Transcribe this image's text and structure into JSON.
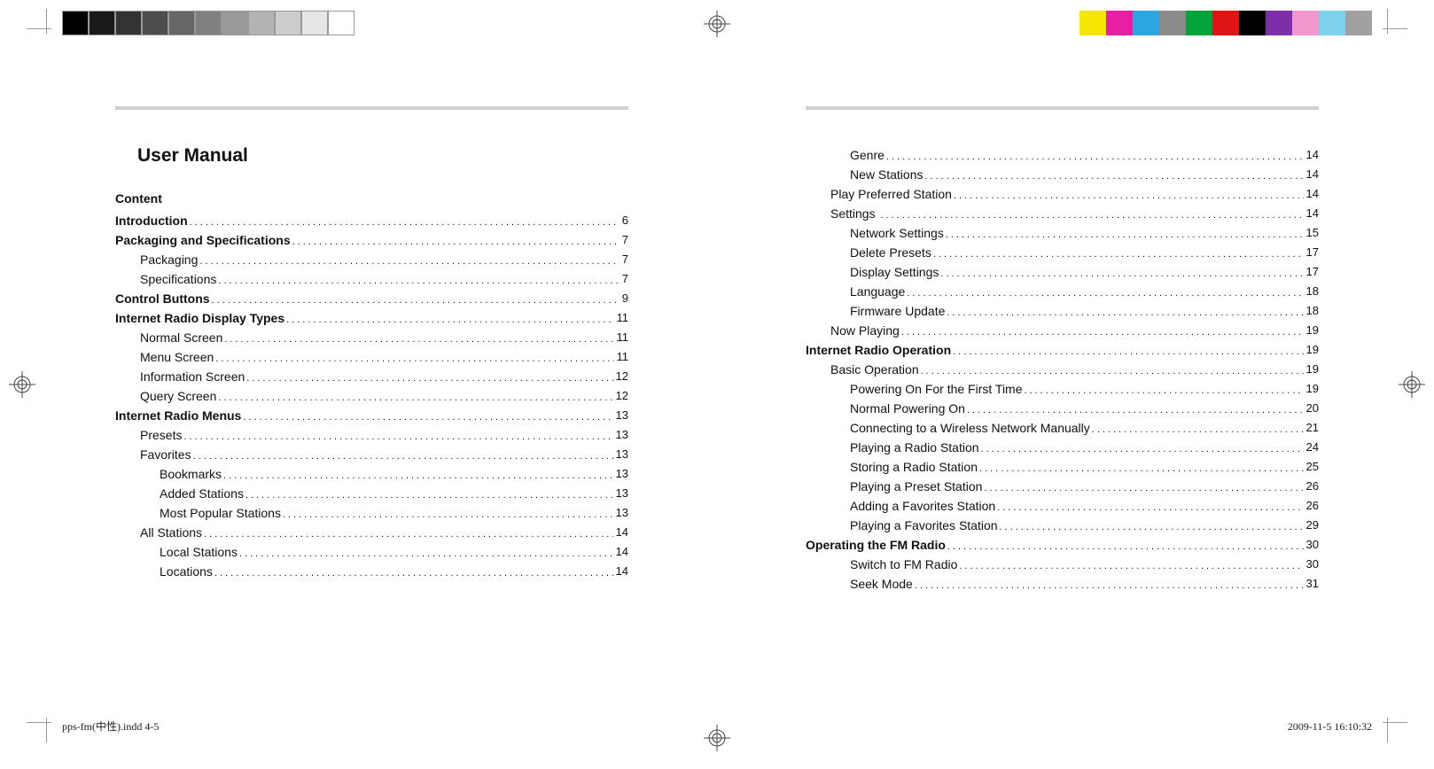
{
  "title": "User Manual",
  "content_label": "Content",
  "footer_left": "pps-fm(中性).indd   4-5",
  "footer_right": "2009-11-5   16:10:32",
  "colorbar_left": [
    "#000000",
    "#1a1a1a",
    "#333333",
    "#4d4d4d",
    "#666666",
    "#808080",
    "#999999",
    "#b3b3b3",
    "#cccccc",
    "#e6e6e6",
    "#ffffff"
  ],
  "colorbar_right": [
    "#f5e600",
    "#e81fa3",
    "#2da6e0",
    "#8b8b8b",
    "#00a43a",
    "#e01414",
    "#000000",
    "#7c2fa8",
    "#f397cf",
    "#7ed1ec",
    "#a0a0a0"
  ],
  "toc_left": [
    {
      "label": "Introduction",
      "page": "6",
      "bold": true,
      "indent": 0
    },
    {
      "label": "Packaging and Specifications",
      "page": "7",
      "bold": true,
      "indent": 0
    },
    {
      "label": "Packaging",
      "page": "7",
      "bold": false,
      "indent": 1
    },
    {
      "label": "Specifications",
      "page": "7",
      "bold": false,
      "indent": 1
    },
    {
      "label": "Control Buttons",
      "page": "9",
      "bold": true,
      "indent": 0
    },
    {
      "label": "Internet Radio Display Types",
      "page": "11",
      "bold": true,
      "indent": 0
    },
    {
      "label": "Normal Screen",
      "page": "11",
      "bold": false,
      "indent": 1
    },
    {
      "label": "Menu Screen",
      "page": "11",
      "bold": false,
      "indent": 1
    },
    {
      "label": "Information Screen",
      "page": "12",
      "bold": false,
      "indent": 1
    },
    {
      "label": "Query Screen",
      "page": "12",
      "bold": false,
      "indent": 1
    },
    {
      "label": "Internet Radio Menus",
      "page": "13",
      "bold": true,
      "indent": 0
    },
    {
      "label": "Presets",
      "page": "13",
      "bold": false,
      "indent": 1
    },
    {
      "label": "Favorites",
      "page": "13",
      "bold": false,
      "indent": 1
    },
    {
      "label": "Bookmarks",
      "page": "13",
      "bold": false,
      "indent": 2
    },
    {
      "label": "Added Stations",
      "page": "13",
      "bold": false,
      "indent": 2
    },
    {
      "label": "Most Popular Stations",
      "page": "13",
      "bold": false,
      "indent": 2
    },
    {
      "label": "All Stations",
      "page": "14",
      "bold": false,
      "indent": 1
    },
    {
      "label": "Local Stations",
      "page": "14",
      "bold": false,
      "indent": 2
    },
    {
      "label": "Locations",
      "page": "14",
      "bold": false,
      "indent": 2
    }
  ],
  "toc_right": [
    {
      "label": "Genre",
      "page": "14",
      "bold": false,
      "indent": 2
    },
    {
      "label": "New Stations",
      "page": "14",
      "bold": false,
      "indent": 2
    },
    {
      "label": "Play Preferred Station",
      "page": "14",
      "bold": false,
      "indent": 1
    },
    {
      "label": "Settings ",
      "page": "14",
      "bold": false,
      "indent": 1
    },
    {
      "label": "Network Settings",
      "page": "15",
      "bold": false,
      "indent": 2
    },
    {
      "label": "Delete Presets",
      "page": "17",
      "bold": false,
      "indent": 2
    },
    {
      "label": "Display Settings",
      "page": "17",
      "bold": false,
      "indent": 2
    },
    {
      "label": "Language",
      "page": "18",
      "bold": false,
      "indent": 2
    },
    {
      "label": "Firmware Update",
      "page": "18",
      "bold": false,
      "indent": 2
    },
    {
      "label": "Now Playing",
      "page": "19",
      "bold": false,
      "indent": 1
    },
    {
      "label": "Internet Radio Operation",
      "page": "19",
      "bold": true,
      "indent": 0
    },
    {
      "label": "Basic Operation",
      "page": "19",
      "bold": false,
      "indent": 1
    },
    {
      "label": "Powering On For the First Time",
      "page": "19",
      "bold": false,
      "indent": 2
    },
    {
      "label": "Normal Powering On",
      "page": "20",
      "bold": false,
      "indent": 2
    },
    {
      "label": "Connecting to a Wireless Network Manually",
      "page": "21",
      "bold": false,
      "indent": 2
    },
    {
      "label": "Playing a Radio Station",
      "page": "24",
      "bold": false,
      "indent": 2
    },
    {
      "label": "Storing a Radio Station",
      "page": "25",
      "bold": false,
      "indent": 2
    },
    {
      "label": "Playing a Preset Station",
      "page": "26",
      "bold": false,
      "indent": 2
    },
    {
      "label": "Adding a Favorites Station",
      "page": "26",
      "bold": false,
      "indent": 2
    },
    {
      "label": "Playing a Favorites Station",
      "page": "29",
      "bold": false,
      "indent": 2
    },
    {
      "label": "Operating the FM Radio",
      "page": "30",
      "bold": true,
      "indent": 0
    },
    {
      "label": "Switch to FM Radio",
      "page": "30",
      "bold": false,
      "indent": 2
    },
    {
      "label": "Seek Mode",
      "page": "31",
      "bold": false,
      "indent": 2
    }
  ]
}
